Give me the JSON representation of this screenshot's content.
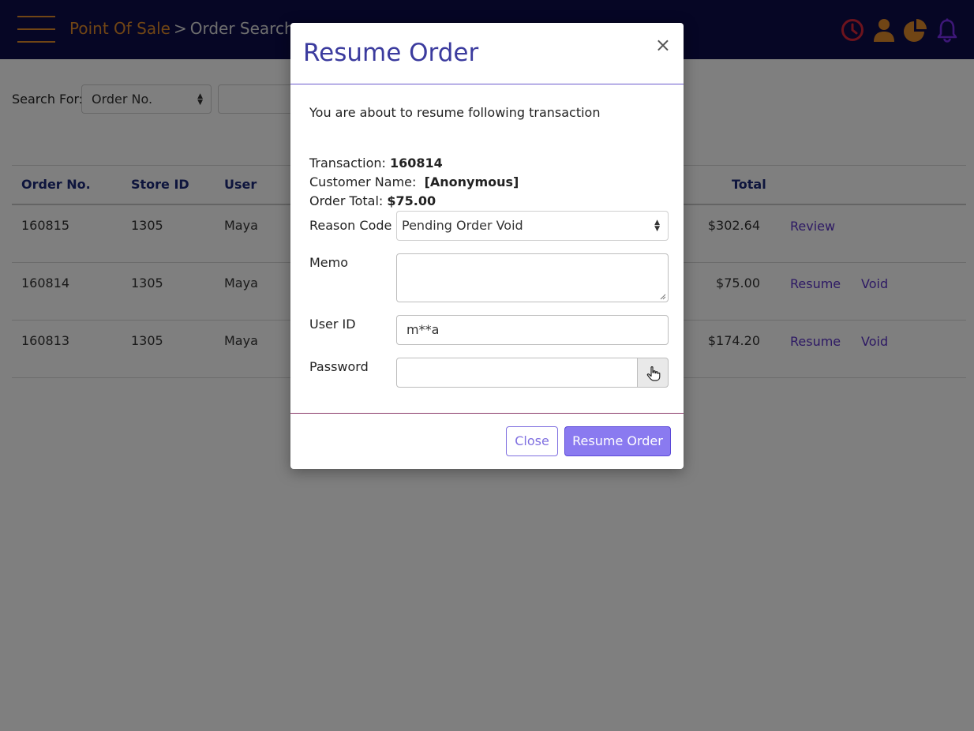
{
  "header": {
    "breadcrumb_home": "Point Of Sale",
    "breadcrumb_separator": ">",
    "breadcrumb_current": "Order Search",
    "icons": [
      "clock-icon",
      "user-icon",
      "pie-chart-icon",
      "bell-icon"
    ],
    "colors": {
      "bar": "#0d0d4a",
      "accent": "#e08a2a",
      "clock": "#d8263a",
      "bell": "#7b2ff0"
    }
  },
  "search": {
    "label": "Search For:",
    "field_value": "Order No."
  },
  "table": {
    "headers": {
      "order_no": "Order No.",
      "store_id": "Store ID",
      "user": "User",
      "total": "Total"
    },
    "rows": [
      {
        "order_no": "160815",
        "store_id": "1305",
        "user": "Maya",
        "total": "$302.64",
        "action1": "Review",
        "action2": ""
      },
      {
        "order_no": "160814",
        "store_id": "1305",
        "user": "Maya",
        "total": "$75.00",
        "action1": "Resume",
        "action2": "Void"
      },
      {
        "order_no": "160813",
        "store_id": "1305",
        "user": "Maya",
        "total": "$174.20",
        "action1": "Resume",
        "action2": "Void"
      }
    ]
  },
  "modal": {
    "title": "Resume Order",
    "close_symbol": "×",
    "intro": "You are about to resume following transaction",
    "transaction_label": "Transaction:",
    "transaction_value": "160814",
    "customer_label": "Customer Name:",
    "customer_value": "[Anonymous]",
    "order_total_label": "Order Total:",
    "order_total_value": "$75.00",
    "reason_label": "Reason Code",
    "reason_value": "Pending Order Void",
    "memo_label": "Memo",
    "memo_value": "",
    "user_id_label": "User ID",
    "user_id_value": "m**a",
    "password_label": "Password",
    "password_value": "",
    "close_button": "Close",
    "resume_button": "Resume Order"
  }
}
